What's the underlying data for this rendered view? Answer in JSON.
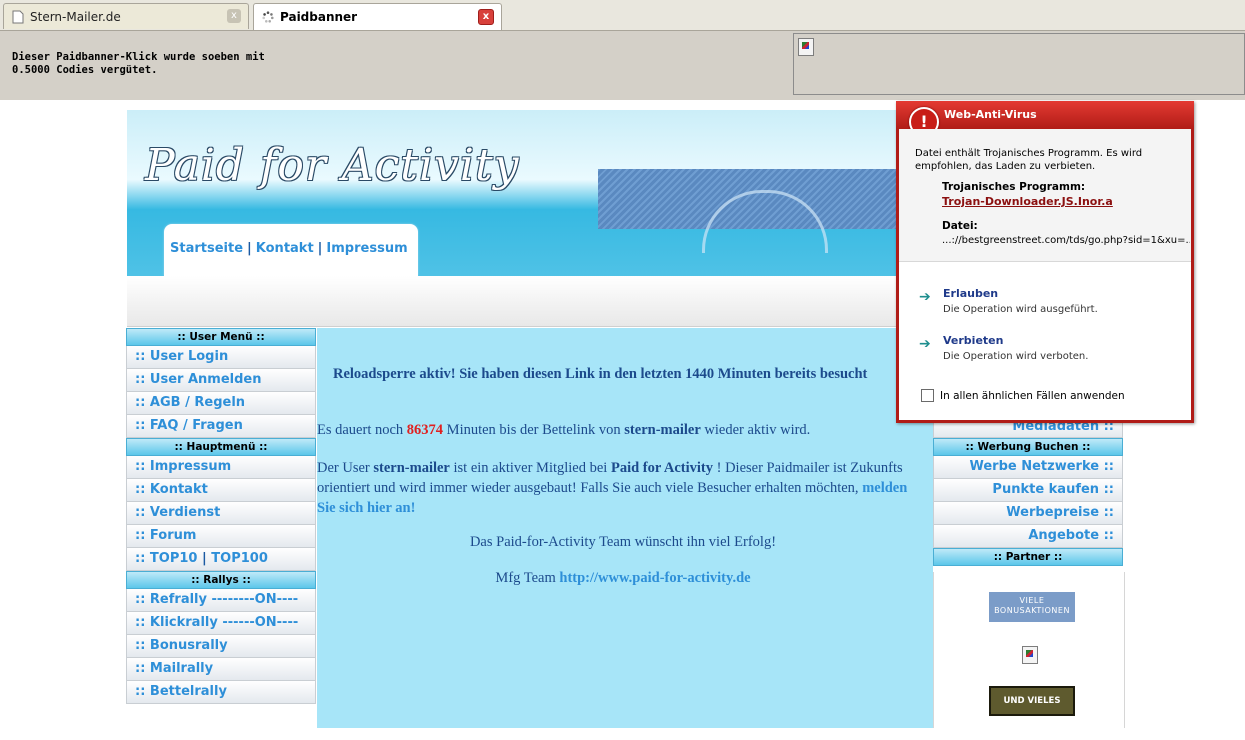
{
  "browser": {
    "tabs": [
      {
        "title": "Stern-Mailer.de",
        "close": "x"
      },
      {
        "title": "Paidbanner",
        "close": "x"
      }
    ]
  },
  "info_bar": {
    "line1": "Dieser Paidbanner-Klick wurde soeben mit",
    "line2": "0.5000 Codies vergütet."
  },
  "site": {
    "logo": "Paid for Activity",
    "nav": {
      "home": "Startseite",
      "sep": "|",
      "contact": "Kontakt",
      "imprint": "Impressum"
    }
  },
  "left_menu": {
    "user_header": ":: User Menü ::",
    "user_items": [
      ":: User Login",
      ":: User Anmelden",
      ":: AGB / Regeln",
      ":: FAQ / Fragen"
    ],
    "main_header": ":: Hauptmenü ::",
    "main_items": [
      ":: Impressum",
      ":: Kontakt",
      ":: Verdienst",
      ":: Forum"
    ],
    "top_item": {
      "prefix": ":: TOP10",
      "sep": "|",
      "suffix": "TOP100"
    },
    "rally_header": ":: Rallys ::",
    "rally_items": [
      ":: Refrally --------ON----",
      ":: Klickrally ------ON----",
      ":: Bonusrally",
      ":: Mailrally",
      ":: Bettelrally"
    ]
  },
  "content": {
    "reload_notice": "Reloadsperre aktiv! Sie haben diesen Link in den letzten 1440 Minuten bereits besucht",
    "p1_pre": "Es dauert noch",
    "p1_minutes": "86374",
    "p1_mid": "Minuten bis der Bettelink von",
    "p1_user": "stern-mailer",
    "p1_post": "wieder aktiv wird.",
    "p2_pre": "Der User",
    "p2_user": "stern-mailer",
    "p2_mid": "ist ein aktiver Mitglied bei",
    "p2_site": "Paid for Activity",
    "p2_post": "! Dieser Paidmailer ist Zukunfts orientiert und wird immer wieder ausgebaut! Falls Sie auch viele Besucher erhalten möchten,",
    "p2_link": "melden Sie sich hier an!",
    "p3": "Das Paid-for-Activity Team wünscht ihn viel Erfolg!",
    "p4_pre": "Mfg Team",
    "p4_link": "http://www.paid-for-activity.de"
  },
  "right_menu": {
    "media": "Mediadaten ::",
    "ads_header": ":: Werbung Buchen ::",
    "ads_items": [
      "Werbe Netzwerke ::",
      "Punkte kaufen ::",
      "Werbepreise ::",
      "Angebote ::"
    ],
    "partner_header": ":: Partner ::",
    "badge1": "VIELE BONUSAKTIONEN",
    "badge2": "UND VIELES MEHR!"
  },
  "antivirus": {
    "title": "Web-Anti-Virus",
    "icon": "!",
    "message": "Datei enthält Trojanisches Programm. Es wird empfohlen, das Laden zu verbieten.",
    "threat_label": "Trojanisches Programm:",
    "threat_name": "Trojan-Downloader.JS.Inor.a",
    "file_label": "Datei:",
    "file_path": "...://bestgreenstreet.com/tds/go.php?sid=1&xu=...",
    "allow_title": "Erlauben",
    "allow_desc": "Die Operation wird ausgeführt.",
    "deny_title": "Verbieten",
    "deny_desc": "Die Operation wird verboten.",
    "checkbox_label": "In allen ähnlichen Fällen anwenden",
    "colors": {
      "title_bar": "#b01c17",
      "action_arrow": "#1f8f8f"
    }
  }
}
